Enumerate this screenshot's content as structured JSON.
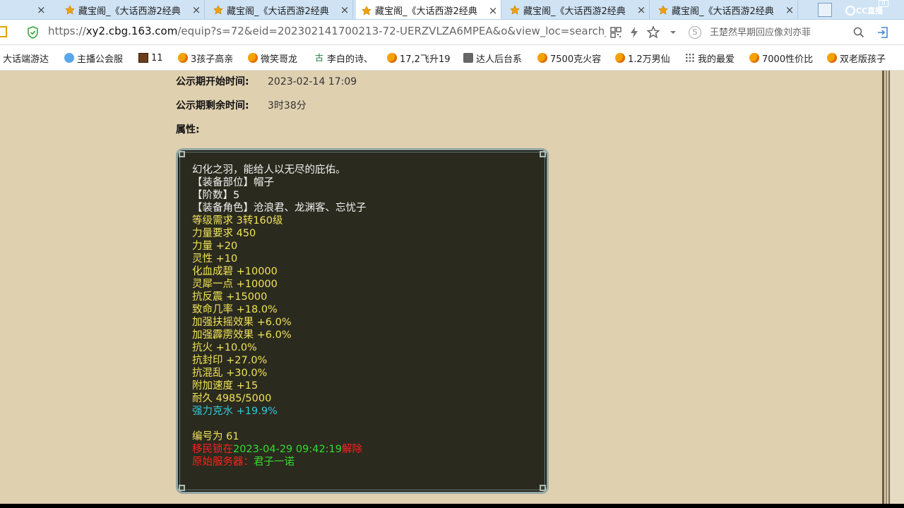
{
  "tabs": [
    {
      "label": "藏宝阁_《大话西游2经典",
      "active": false
    },
    {
      "label": "藏宝阁_《大话西游2经典",
      "active": false
    },
    {
      "label": "藏宝阁_《大话西游2经典",
      "active": true
    },
    {
      "label": "藏宝阁_《大话西游2经典",
      "active": false
    },
    {
      "label": "藏宝阁_《大话西游2经典",
      "active": false
    }
  ],
  "tab_close": "×",
  "brand_logo": "CC直播",
  "top_badge": "0",
  "address": {
    "prefix": "https://",
    "host": "xy2.cbg.163.com",
    "path": "/equip?s=72&eid=202302141700213-72-UERZVLZA6MPEA&o&view_loc=search_",
    "search_placeholder": "王楚然早期回应像刘亦菲"
  },
  "bookmarks": [
    {
      "label": "大话端游达",
      "icon": "none"
    },
    {
      "label": "主播公会服",
      "icon": "blue"
    },
    {
      "label": "11",
      "icon": "game"
    },
    {
      "label": "3孩子高亲",
      "icon": "ball"
    },
    {
      "label": "微笑哥龙",
      "icon": "ball"
    },
    {
      "label": "李白的诗、",
      "icon": "gu"
    },
    {
      "label": "17,2飞升19",
      "icon": "ball"
    },
    {
      "label": "达人后台系",
      "icon": "doc"
    },
    {
      "label": "7500克火容",
      "icon": "ball"
    },
    {
      "label": "1.2万男仙",
      "icon": "ball"
    },
    {
      "label": "我的最爱",
      "icon": "grid"
    },
    {
      "label": "7000性价比",
      "icon": "ball"
    },
    {
      "label": "双老版孩子",
      "icon": "ball"
    }
  ],
  "info": {
    "start_label": "公示期开始时间:",
    "start_value": "2023-02-14 17:09",
    "remain_label": "公示期剩余时间:",
    "remain_value": "3时38分",
    "attr_label": "属性:"
  },
  "item": {
    "desc": "幻化之羽，能给人以无尽的庇佑。",
    "slot": "【装备部位】帽子",
    "tier": "【阶数】5",
    "roles": "【装备角色】沧浪君、龙渊客、忘忧子",
    "stats": [
      "等级需求 3转160级",
      "力量要求 450",
      "力量 +20",
      "灵性 +10",
      "化血成碧 +10000",
      "灵犀一点 +10000",
      "抗反震 +15000",
      "致命几率 +18.0%",
      "加强扶摇效果 +6.0%",
      "加强霹雳效果 +6.0%",
      "抗火 +10.0%",
      "抗封印 +27.0%",
      "抗混乱 +30.0%",
      "附加速度 +15",
      "耐久 4985/5000"
    ],
    "special": "强力克水 +19.9%",
    "serial": "编号为 61",
    "migrate_prefix": "移民锁在",
    "migrate_time": "2023-04-29 09:42:19",
    "migrate_suffix": "解除",
    "origin_label": "原始服务器：",
    "origin_server": "君子一诺"
  }
}
